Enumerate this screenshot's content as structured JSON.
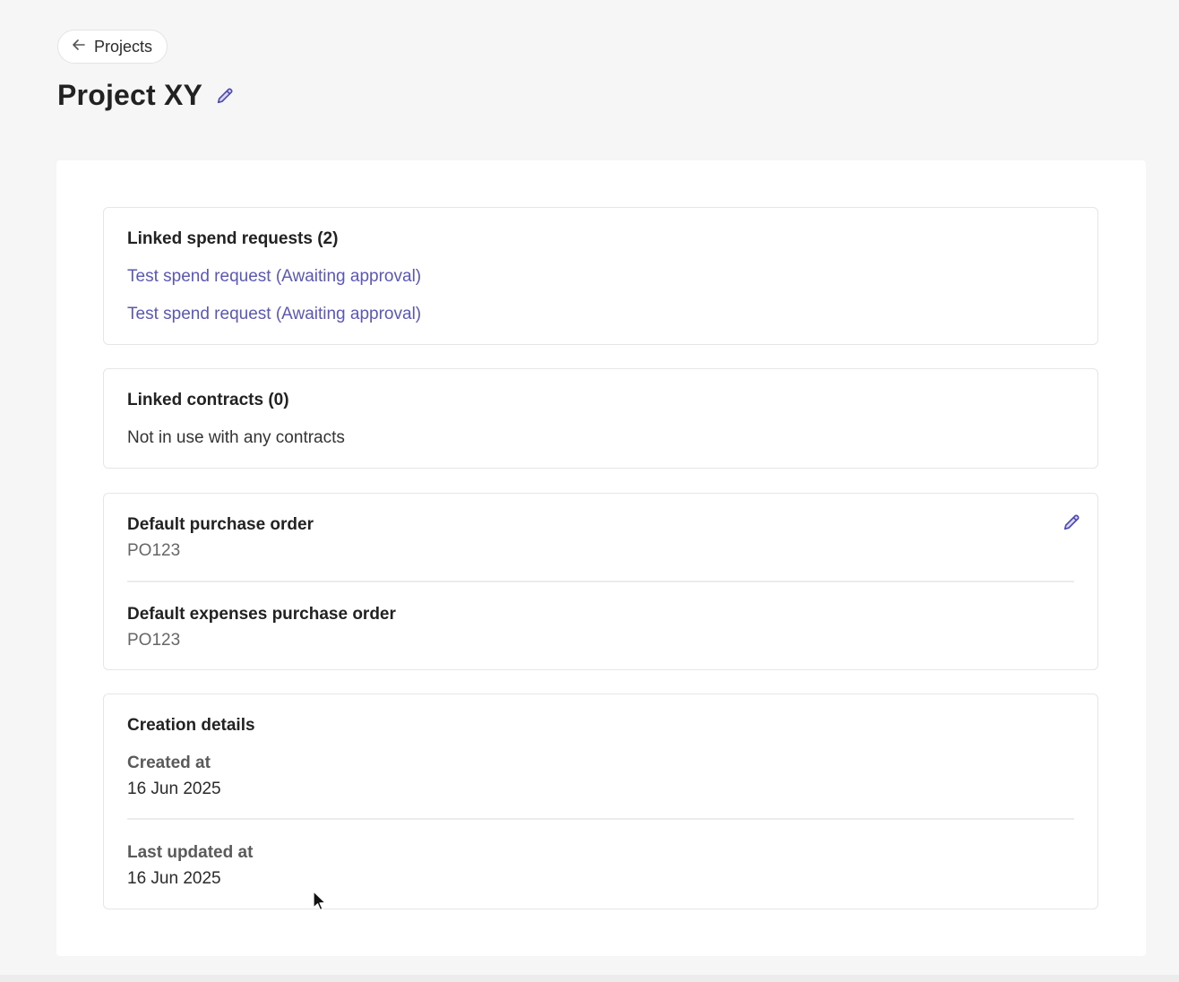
{
  "header": {
    "back_label": "Projects",
    "title": "Project XY"
  },
  "spend_requests": {
    "title": "Linked spend requests (2)",
    "items": [
      "Test spend request (Awaiting approval)",
      "Test spend request (Awaiting approval)"
    ]
  },
  "contracts": {
    "title": "Linked contracts (0)",
    "empty_text": "Not in use with any contracts"
  },
  "purchase_orders": {
    "default_label": "Default purchase order",
    "default_value": "PO123",
    "expenses_label": "Default expenses purchase order",
    "expenses_value": "PO123"
  },
  "creation": {
    "title": "Creation details",
    "created_label": "Created at",
    "created_value": "16 Jun 2025",
    "updated_label": "Last updated at",
    "updated_value": "16 Jun 2025"
  },
  "colors": {
    "accent": "#5b57b8",
    "page_bg": "#f6f6f6",
    "card_border": "#e6e6e6"
  },
  "icons": [
    "arrow-left-icon",
    "pencil-icon",
    "cursor-icon"
  ]
}
